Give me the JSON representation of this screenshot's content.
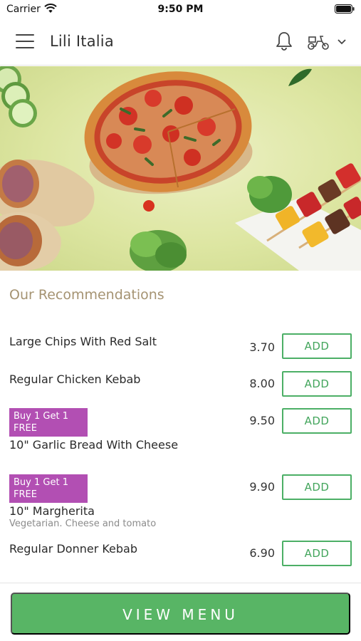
{
  "status_bar": {
    "carrier": "Carrier",
    "time": "9:50 PM"
  },
  "header": {
    "title": "Lili Italia",
    "icons": [
      "menu-icon",
      "bell-icon",
      "scooter-icon",
      "chevron-down-icon"
    ]
  },
  "hero": {
    "image": "food-banner-pizza-wraps-kebab-skewers"
  },
  "recommendations": {
    "title": "Our Recommendations",
    "items": [
      {
        "name": "Large Chips With Red Salt",
        "price": "3.70",
        "button": "ADD"
      },
      {
        "name": "Regular Chicken Kebab",
        "price": "8.00",
        "button": "ADD"
      },
      {
        "badge": "Buy 1 Get 1 FREE",
        "name": "10\" Garlic Bread With Cheese",
        "price": "9.50",
        "button": "ADD"
      },
      {
        "badge": "Buy 1 Get 1 FREE",
        "name": "10\" Margherita",
        "description": "Vegetarian. Cheese and tomato",
        "price": "9.90",
        "button": "ADD"
      },
      {
        "name": "Regular Donner Kebab",
        "price": "6.90",
        "button": "ADD"
      }
    ]
  },
  "footer": {
    "button": "VIEW MENU"
  },
  "colors": {
    "accent_green": "#58b565",
    "badge_purple": "#b24fb3",
    "section_title": "#a59372"
  }
}
